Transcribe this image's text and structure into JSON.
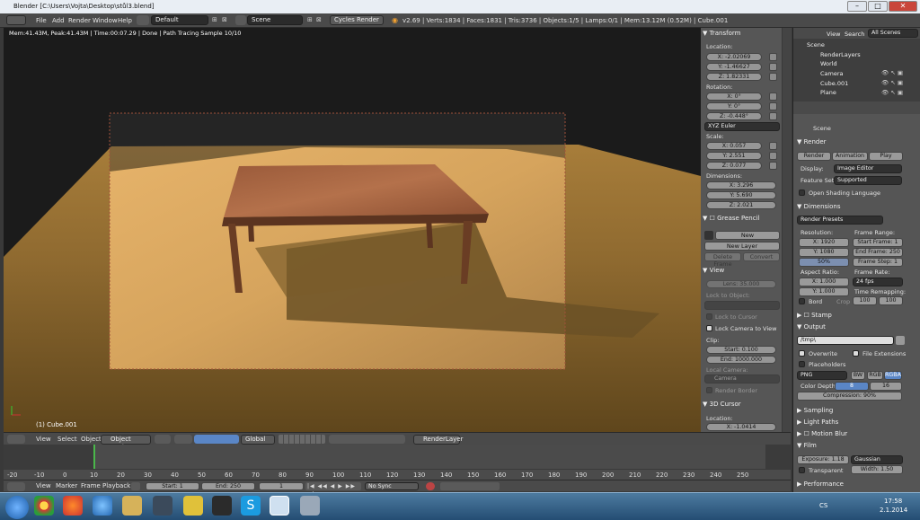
{
  "window": {
    "title": "Blender [C:\\Users\\Vojta\\Desktop\\stůl3.blend]"
  },
  "topbar": {
    "menus": [
      "File",
      "Add",
      "Render",
      "Window",
      "Help"
    ],
    "layout": "Default",
    "scene": "Scene",
    "engine": "Cycles Render",
    "stats": "v2.69 | Verts:1834 | Faces:1831 | Tris:3736 | Objects:1/5 | Lamps:0/1 | Mem:13.12M (0.52M) | Cube.001"
  },
  "viewport": {
    "info": "Mem:41.43M, Peak:41.43M | Time:00:07.29 | Done | Path Tracing Sample 10/10",
    "object_label": "(1) Cube.001"
  },
  "npanel": {
    "transform": "Transform",
    "location_label": "Location:",
    "location": [
      "X: -2.02069",
      "Y: -1.46627",
      "Z: 1.82331"
    ],
    "rotation_label": "Rotation:",
    "rotation": [
      "X: 0°",
      "Y: 0°",
      "Z: -0.448°"
    ],
    "rotation_mode": "XYZ Euler",
    "scale_label": "Scale:",
    "scale": [
      "X: 0.057",
      "Y: 2.551",
      "Z: 0.077"
    ],
    "dimensions_label": "Dimensions:",
    "dimensions": [
      "X: 3.296",
      "Y: 5.690",
      "Z: 2.021"
    ],
    "grease_pencil": "Grease Pencil",
    "gp_new": "New",
    "gp_new_layer": "New Layer",
    "gp_delete_frame": "Delete Frame",
    "gp_convert": "Convert",
    "view": "View",
    "lens": "Lens: 35.000",
    "lock_to_object": "Lock to Object:",
    "lock_to_cursor": "Lock to Cursor",
    "lock_camera": "Lock Camera to View",
    "clip_label": "Clip:",
    "clip_start": "Start: 0.100",
    "clip_end": "End: 1000.000",
    "local_camera": "Local Camera:",
    "camera": "Camera",
    "render_border": "Render Border",
    "cursor_3d": "3D Cursor",
    "cursor_location": "Location:",
    "cursor_x": "X: -1.0414"
  },
  "outliner": {
    "view": "View",
    "search": "Search",
    "filter": "All Scenes",
    "items": [
      "Scene",
      "RenderLayers",
      "World",
      "Camera",
      "Cube.001",
      "Plane"
    ]
  },
  "properties": {
    "scene": "Scene",
    "render": "Render",
    "render_btn": "Render",
    "animation_btn": "Animation",
    "play_btn": "Play",
    "display_label": "Display:",
    "display": "Image Editor",
    "feature_label": "Feature Set:",
    "feature": "Supported",
    "open_shading": "Open Shading Language",
    "dimensions": "Dimensions",
    "render_presets": "Render Presets",
    "resolution_label": "Resolution:",
    "res_x": "X: 1920",
    "res_y": "Y: 1080",
    "res_pct": "50%",
    "frame_range_label": "Frame Range:",
    "start_frame": "Start Frame: 1",
    "end_frame": "End Frame: 250",
    "frame_step": "Frame Step: 1",
    "aspect_label": "Aspect Ratio:",
    "asp_x": "X: 1.000",
    "asp_y": "Y: 1.000",
    "frame_rate_label": "Frame Rate:",
    "fps": "24 fps",
    "time_remap_label": "Time Remapping:",
    "remap_old": "100",
    "remap_new": "100",
    "bord": "Bord",
    "crop": "Crop",
    "stamp": "Stamp",
    "output": "Output",
    "output_path": "/tmp\\",
    "overwrite": "Overwrite",
    "file_ext": "File Extensions",
    "placeholders": "Placeholders",
    "format": "PNG",
    "bw": "BW",
    "rgb": "RGB",
    "rgba": "RGBA",
    "color_depth_label": "Color Depth:",
    "depth8": "8",
    "depth16": "16",
    "compression": "Compression: 90%",
    "sampling": "Sampling",
    "light_paths": "Light Paths",
    "motion_blur": "Motion Blur",
    "film": "Film",
    "exposure": "Exposure: 1.18",
    "filter": "Gaussian",
    "transparent": "Transparent",
    "width": "Width: 1.50",
    "performance": "Performance"
  },
  "view_header": {
    "menus": [
      "View",
      "Select",
      "Object"
    ],
    "mode": "Object Mode",
    "orientation": "Global",
    "render_layer": "RenderLayer"
  },
  "timeline": {
    "ruler": [
      "-20",
      "-10",
      "0",
      "10",
      "20",
      "30",
      "40",
      "50",
      "60",
      "70",
      "80",
      "90",
      "100",
      "110",
      "120",
      "130",
      "140",
      "150",
      "160",
      "170",
      "180",
      "190",
      "200",
      "210",
      "220",
      "230",
      "240",
      "250"
    ],
    "menus": [
      "View",
      "Marker",
      "Frame",
      "Playback"
    ],
    "start": "Start: 1",
    "end": "End: 250",
    "current": "1",
    "sync": "No Sync"
  },
  "taskbar": {
    "lang": "CS",
    "time": "17:58",
    "date": "2.1.2014"
  }
}
